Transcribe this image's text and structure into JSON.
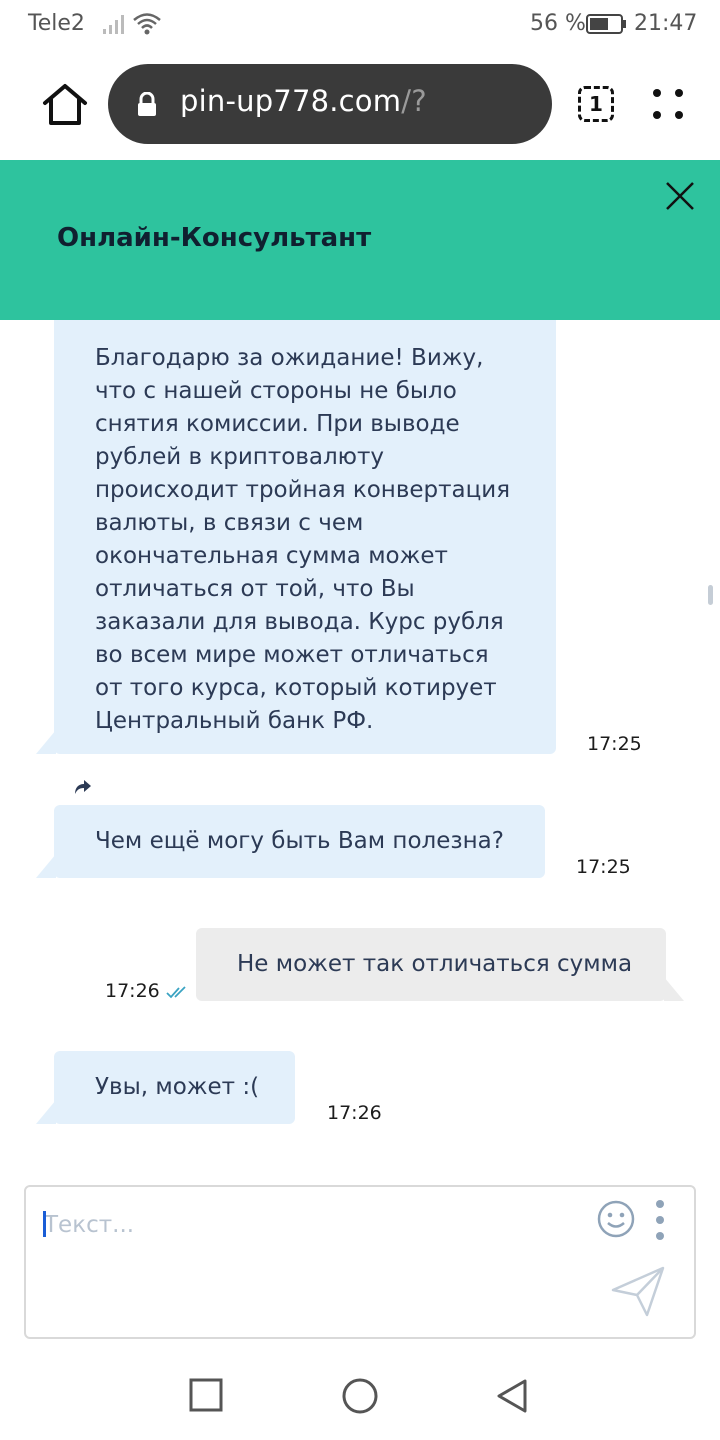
{
  "status_bar": {
    "carrier": "Tele2",
    "battery_percent": "56 %",
    "time": "21:47"
  },
  "browser": {
    "url_host": "pin-up778.com",
    "url_path": "/?",
    "tab_count": "1"
  },
  "chat": {
    "title": "Онлайн-Консультант",
    "messages": [
      {
        "direction": "incoming",
        "lines": [
          "Благодарю за ожидание! Вижу,",
          "что с нашей стороны не было",
          "снятия комиссии. При выводе",
          "рублей в криптовалюту",
          "происходит тройная конвертация",
          "валюты, в связи с чем",
          "окончательная сумма может",
          "отличаться от той, что Вы",
          "заказали для вывода. Курс рубля",
          "во всем мире может отличаться",
          "от того курса, который котирует",
          "Центральный банк РФ."
        ],
        "time": "17:25"
      },
      {
        "direction": "incoming",
        "text": "Чем ещё могу быть Вам полезна?",
        "time": "17:25"
      },
      {
        "direction": "outgoing",
        "text": "Не может так отличаться сумма",
        "time": "17:26"
      },
      {
        "direction": "incoming",
        "text": "Увы, может :(",
        "time": "17:26"
      }
    ]
  },
  "composer": {
    "placeholder": "Текст..."
  },
  "colors": {
    "header": "#2ec39e",
    "incoming_bubble": "#e3f0fb",
    "outgoing_bubble": "#ececec",
    "text": "#2c3a55",
    "read_check": "#3aa3c2"
  },
  "icons": [
    "signal-icon",
    "wifi-icon",
    "battery-icon",
    "home-icon",
    "lock-icon",
    "tabs-icon",
    "menu-dots-icon",
    "close-icon",
    "forward-icon",
    "double-check-icon",
    "emoji-icon",
    "more-vertical-icon",
    "send-icon",
    "recent-apps-icon",
    "home-circle-icon",
    "back-icon"
  ]
}
